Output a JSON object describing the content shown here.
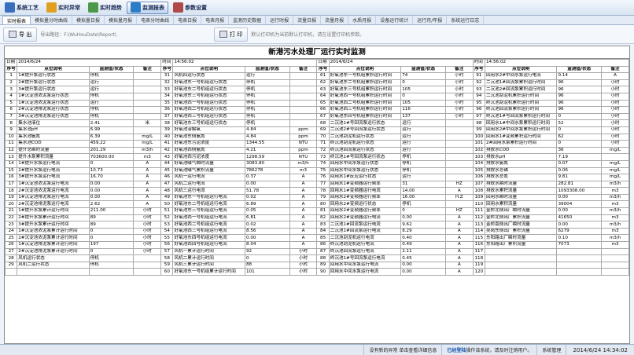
{
  "toolbar": [
    {
      "label": "系统工艺",
      "icon": "process-icon",
      "color": "#3a6fc0"
    },
    {
      "label": "实时异常",
      "icon": "alarm-icon",
      "color": "#e0a020"
    },
    {
      "label": "实时趋势",
      "icon": "trend-icon",
      "color": "#4a9a4a"
    },
    {
      "label": "监测报表",
      "icon": "report-icon",
      "color": "#2c7dc8",
      "active": true
    },
    {
      "label": "参数设置",
      "icon": "settings-icon",
      "color": "#b04a4a"
    }
  ],
  "tabs": [
    "实时报表",
    "模拟量分时曲线",
    "模拟量日报",
    "模拟量月报",
    "电表分时曲线",
    "电表日报",
    "电表月报",
    "监测历史数据",
    "运行时报",
    "流量日报",
    "流量月报",
    "水质月报",
    "设备运行统计",
    "运行月/年报",
    "系统运行日志"
  ],
  "actionbar": {
    "export_label": "导 出",
    "path_label": "导出路径：F:\\WuHouDate\\Report\\",
    "print_label": "打 印",
    "hint": "默认打印机为当前默认打印机，请在设置打印机参数。"
  },
  "report": {
    "title": "新港污水处理厂运行实时监测",
    "meta": {
      "date_label": "日期",
      "date": "2014/6/24",
      "time_label": "时间",
      "time": "14:56:02",
      "date2": "2014/6/24",
      "time2": "14:56:02"
    },
    "headers": [
      "序号",
      "点位说明",
      "监测值/状态",
      "备注"
    ],
    "blocks": [
      [
        [
          "1",
          "1#提升泵运行状态",
          "停机",
          ""
        ],
        [
          "2",
          "2#提升泵运行状态",
          "运行",
          ""
        ],
        [
          "3",
          "3#提升泵运行状态",
          "运行",
          ""
        ],
        [
          "4",
          "1#沉淀池浓泥泵运行状态",
          "停机",
          ""
        ],
        [
          "5",
          "1#沉淀池浓泥泵运行状态",
          "运行",
          ""
        ],
        [
          "6",
          "2#沉淀池排泥泵运行状态",
          "停机",
          ""
        ],
        [
          "7",
          "3#沉淀池排泥泵运行状态",
          "停机",
          ""
        ],
        [
          "8",
          "集水池液位",
          "2.41",
          "米"
        ],
        [
          "9",
          "集水池pH",
          "6.99",
          ""
        ],
        [
          "10",
          "集水池氨氮",
          "6.39",
          "mg/L"
        ],
        [
          "11",
          "集水池COD",
          "459.22",
          "mg/L"
        ],
        [
          "12",
          "提升总瞬时流量",
          "201.29",
          "m3/h"
        ],
        [
          "13",
          "提升水泵累积流量",
          "703600.00",
          "m3"
        ],
        [
          "14",
          "1#提升水泵运行电流",
          "0",
          "A"
        ],
        [
          "15",
          "2#提升水泵运行电流",
          "10.73",
          "A"
        ],
        [
          "16",
          "3#提升水泵运行电流",
          "16.70",
          "A"
        ],
        [
          "17",
          "1#沉淀池浓泥泵运行电流",
          "0.00",
          "A"
        ],
        [
          "18",
          "2#沉淀池浓泥泵运行电流",
          "0.00",
          "A"
        ],
        [
          "19",
          "1#沉淀池排泥泵运行电流",
          "0.00",
          "A"
        ],
        [
          "20",
          "2#沉淀池排泥泵运行电流",
          "2.62",
          "A"
        ],
        [
          "21",
          "1#提升水泵累计运行时间",
          "211.00",
          "小时"
        ],
        [
          "22",
          "2#提升水泵累计运行时间",
          "89",
          "小时"
        ],
        [
          "23",
          "3#提升水泵累计运行时间",
          "89",
          "小时"
        ],
        [
          "24",
          "1#沉淀池浓泥泵累计运行时间",
          "0",
          "小时"
        ],
        [
          "25",
          "2#沉淀池浓泥泵累计运行时间",
          "0",
          "小时"
        ],
        [
          "26",
          "1#沉淀池排泥泵累计运行时间",
          "197",
          "小时"
        ],
        [
          "27",
          "2#沉淀池排泥泵累计运行时间",
          "0",
          "小时"
        ],
        [
          "28",
          "风机运行状态",
          "停机",
          ""
        ],
        [
          "29",
          "风机二运行状态",
          "停机",
          ""
        ]
      ],
      [
        [
          "31",
          "风机四运行状态",
          "运行",
          ""
        ],
        [
          "32",
          "好氧池东一号机组运行状态",
          "停机",
          ""
        ],
        [
          "33",
          "好氧池东二号机组运行状态",
          "停机",
          ""
        ],
        [
          "34",
          "好氧池东三号机组运行状态",
          "停机",
          ""
        ],
        [
          "35",
          "好氧池西一号机组运行状态",
          "停机",
          ""
        ],
        [
          "36",
          "好氧池西二号机组运行状态",
          "停机",
          ""
        ],
        [
          "37",
          "好氧池西三号机组运行状态",
          "停机",
          ""
        ],
        [
          "38",
          "好氧池东三号机组运行状态",
          "停机",
          ""
        ],
        [
          "39",
          "好氧池溶解氧",
          "4.84",
          "ppm"
        ],
        [
          "40",
          "好氧池东侧氨氮",
          "4.84",
          "ppm"
        ],
        [
          "41",
          "好氧池东污泥浓度",
          "1344.55",
          "NTU"
        ],
        [
          "42",
          "好氧池西侧氨氮",
          "4.21",
          "ppm"
        ],
        [
          "43",
          "好氧池西污泥浓度",
          "1298.59",
          "NTU"
        ],
        [
          "44",
          "好氧池曝气瞬时流量",
          "3083.80",
          "m3/h"
        ],
        [
          "45",
          "好氧池曝气累积流量",
          "786278",
          "m3"
        ],
        [
          "46",
          "风机一运行电流",
          "0.37",
          "A"
        ],
        [
          "47",
          "风机二运行电流",
          "0.00",
          "A"
        ],
        [
          "48",
          "风机三运行电流",
          "51.78",
          "A"
        ],
        [
          "49",
          "好氧池东一号机组运行电流",
          "0.02",
          "A"
        ],
        [
          "50",
          "好氧池东二号机组运行电流",
          "6.89",
          "A"
        ],
        [
          "51",
          "好氧池东三号机组运行电流",
          "0.05",
          "A"
        ],
        [
          "52",
          "好氧池西一号机组运行电流",
          "6.81",
          "A"
        ],
        [
          "53",
          "好氧池西二号机组运行电流",
          "0.02",
          "A"
        ],
        [
          "54",
          "好氧池西三号机组运行电流",
          "8.56",
          "A"
        ],
        [
          "55",
          "好氧池东四号机组运行电流",
          "0.00",
          "A"
        ],
        [
          "56",
          "好氧池西四号机组运行电流",
          "8.04",
          "A"
        ],
        [
          "57",
          "风机一累计运行时间",
          "92",
          "小时"
        ],
        [
          "58",
          "风机二累计运行时间",
          "0",
          "小时"
        ],
        [
          "59",
          "风机三累计运行时间",
          "88",
          "小时"
        ],
        [
          "60",
          "好氧池东一号机组累计运行时间",
          "101",
          "小时"
        ]
      ],
      [
        [
          "61",
          "好氧池东一号机组累积运行时间",
          "74",
          "小时"
        ],
        [
          "62",
          "好氧池东二号机组累积运行时间",
          "0",
          "小时"
        ],
        [
          "63",
          "好氧池东三号机组累积运行时间",
          "105",
          "小时"
        ],
        [
          "64",
          "好氧池西一号机组累积运行时间",
          "0",
          "小时"
        ],
        [
          "65",
          "好氧池西二号机组累积运行时间",
          "105",
          "小时"
        ],
        [
          "66",
          "好氧池西三号机组累积运行时间",
          "116",
          "小时"
        ],
        [
          "67",
          "好氧池东四号机组累积运行时间",
          "137",
          "小时"
        ],
        [
          "68",
          "二沉池1#号回流泵运行状态",
          "运行",
          ""
        ],
        [
          "69",
          "二沉池2#号回流泵运行状态",
          "运行",
          ""
        ],
        [
          "70",
          "二沉池刮泥机运行状态",
          "运行",
          ""
        ],
        [
          "71",
          "终沉池刮泥机运行状态",
          "运行",
          ""
        ],
        [
          "72",
          "终沉池回流泵运行状态",
          "运行",
          ""
        ],
        [
          "73",
          "终沉池1#号回流泵运行状态",
          "停机",
          ""
        ],
        [
          "74",
          "回用水中间水泵运行状态",
          "停机",
          ""
        ],
        [
          "75",
          "回用水中间水泵运行状态",
          "停机",
          ""
        ],
        [
          "76",
          "回用水1#反应运行状态",
          "运行",
          ""
        ],
        [
          "77",
          "回用水1#变频器运行频率",
          "31",
          "HZ"
        ],
        [
          "78",
          "回用水1#变频器运行电流",
          "14.00",
          "A"
        ],
        [
          "79",
          "回用水2#变频器运行频率",
          "16.00",
          "H.Z"
        ],
        [
          "80",
          "回用水2#变频运行状态",
          "停机",
          ""
        ],
        [
          "81",
          "回用水2#变频器运行频率",
          "0",
          "HZ"
        ],
        [
          "82",
          "回用水2#变频器运行电流",
          "0.00",
          "A"
        ],
        [
          "83",
          "二沉池1#回流泵运行电流",
          "9.62",
          "A"
        ],
        [
          "84",
          "二沉池1#回流泵运行电流",
          "8.29",
          "A"
        ],
        [
          "85",
          "二沉池刮泥机运行电流",
          "0.40",
          "A"
        ],
        [
          "86",
          "终沉池刮泥机运行电流",
          "0.49",
          "A"
        ],
        [
          "87",
          "终沉池回流泵运行电流",
          "2.11",
          "A"
        ],
        [
          "88",
          "终沉池1#号回流泵运行电流",
          "0.45",
          "A"
        ],
        [
          "89",
          "回用水中间水泵运行电流",
          "0.00",
          "A"
        ],
        [
          "90",
          "回用水中间水泵运行电流",
          "0.00",
          "A"
        ]
      ],
      [
        [
          "91",
          "回用水2#中间水泵运行电流",
          "0.14",
          "A"
        ],
        [
          "92",
          "二沉池1#回流泵累积运行时间",
          "96",
          "小时"
        ],
        [
          "93",
          "二沉池2#回流泵累积运行时间",
          "96",
          "小时"
        ],
        [
          "94",
          "二沉池刮泥机累积运行时间",
          "96",
          "小时"
        ],
        [
          "95",
          "终沉池刮泥机累积运行时间",
          "96",
          "小时"
        ],
        [
          "96",
          "终沉池回流泵累积运行时间",
          "96",
          "小时"
        ],
        [
          "97",
          "终沉池1#号回流泵累积运行时间",
          "0",
          "小时"
        ],
        [
          "98",
          "回用水1#中间水泵累积运行时间",
          "52",
          "小时"
        ],
        [
          "99",
          "回用水2#中间水泵累积运行时间",
          "0",
          "小时"
        ],
        [
          "100",
          "回用水1#变频累积运行时间",
          "62",
          "小时"
        ],
        [
          "101",
          "2#回用水泵累积运行时间",
          "0",
          "小时"
        ],
        [
          "102",
          "排放水COD",
          "36",
          "mg/L"
        ],
        [
          "103",
          "排放水pH",
          "7.19",
          ""
        ],
        [
          "104",
          "排放水氨氮",
          "0.07",
          "mg/L"
        ],
        [
          "105",
          "排放水总磷",
          "0.06",
          "mg/L"
        ],
        [
          "106",
          "排放水总氮",
          "9.81",
          "mg/L"
        ],
        [
          "107",
          "排放水瞬时流量",
          "282.81",
          "m3/h"
        ],
        [
          "108",
          "排放水累积流量",
          "1093308.00",
          "m3"
        ],
        [
          "109",
          "回用水瞬时流量",
          "0.00",
          "m3/h"
        ],
        [
          "110",
          "回用水累积流量",
          "39004",
          "m3"
        ],
        [
          "111",
          "金桥北侧出厂瞬时流量",
          "0.00",
          "m3/h"
        ],
        [
          "112",
          "金桥北侧出厂累积流量",
          "41650",
          "m3"
        ],
        [
          "113",
          "金桥南侧出厂瞬时流量",
          "0.00",
          "m3/h"
        ],
        [
          "114",
          "吴岗东侧出厂累积流量",
          "6279",
          "m3"
        ],
        [
          "115",
          "东阳路出厂瞬时流量",
          "0.10",
          "m3/h"
        ],
        [
          "116",
          "东阳路出厂累积流量",
          "7073",
          "m3"
        ],
        [
          "117",
          "",
          "",
          ""
        ],
        [
          "118",
          "",
          "",
          ""
        ],
        [
          "119",
          "",
          "",
          ""
        ],
        [
          "120",
          "",
          "",
          ""
        ]
      ]
    ]
  },
  "statusbar": {
    "msg1": "没有新的异常 单击查看详细信息",
    "msg2": "已经登陆",
    "msg3": "操作该系统，请及时注销用户。",
    "user": "系统管理",
    "datetime": "2014/6/24 14:34:02"
  }
}
